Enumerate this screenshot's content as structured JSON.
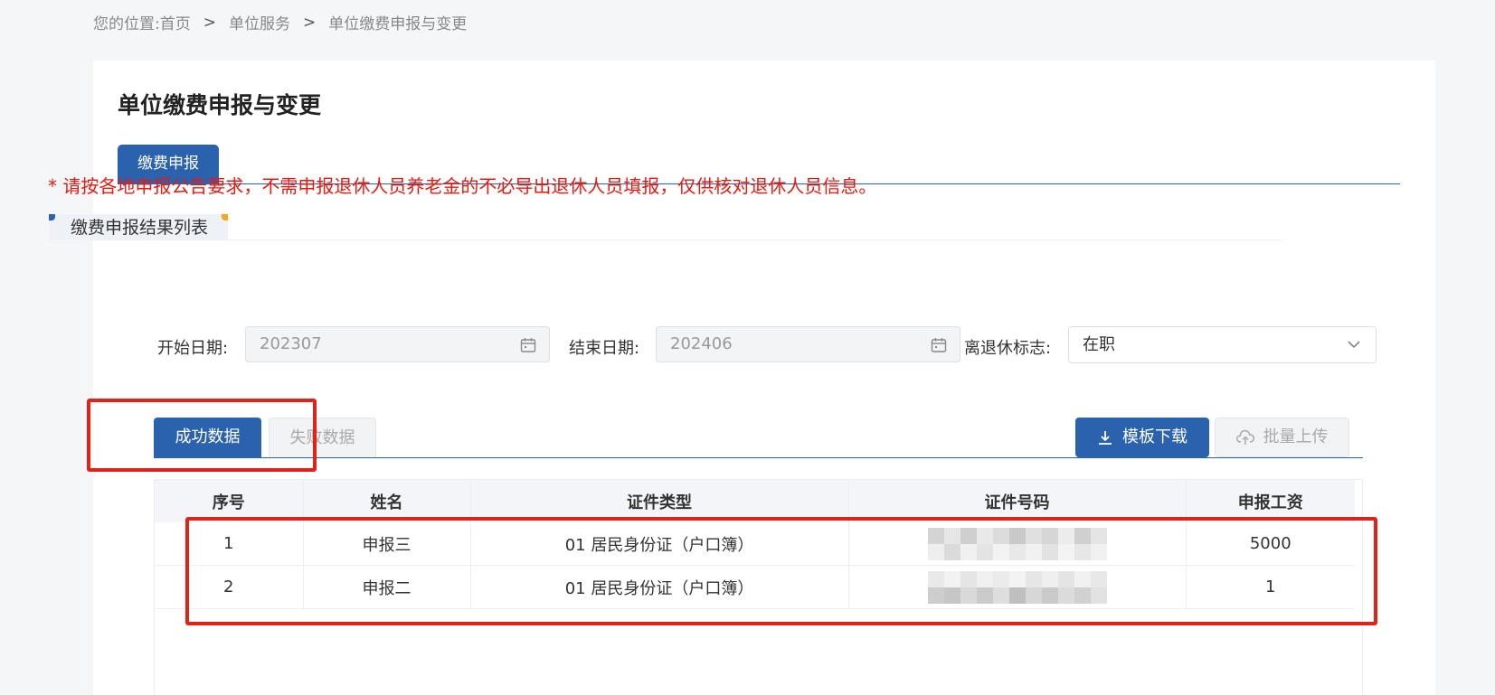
{
  "breadcrumb": {
    "prefix": "您的位置:",
    "items": [
      "首页",
      "单位服务",
      "单位缴费申报与变更"
    ],
    "separator": ">"
  },
  "page": {
    "title": "单位缴费申报与变更"
  },
  "main_tabs": [
    {
      "label": "缴费申报",
      "active": true
    }
  ],
  "notice": "* 请按各地申报公告要求，不需申报退休人员养老金的不必导出退休人员填报，仅供核对退休人员信息。",
  "section": {
    "title": "缴费申报结果列表"
  },
  "filters": {
    "start_date": {
      "label": "开始日期:",
      "value": "202307",
      "icon": "calendar-icon"
    },
    "end_date": {
      "label": "结束日期:",
      "value": "202406",
      "icon": "calendar-icon"
    },
    "retire_flag": {
      "label": "离退休标志:",
      "value": "在职",
      "icon": "chevron-down-icon"
    }
  },
  "sub_tabs": [
    {
      "label": "成功数据",
      "active": true
    },
    {
      "label": "失败数据",
      "active": false
    }
  ],
  "actions": {
    "download": {
      "label": "模板下载",
      "icon": "download-icon"
    },
    "upload": {
      "label": "批量上传",
      "icon": "cloud-upload-icon",
      "disabled": true
    }
  },
  "table": {
    "columns": [
      "序号",
      "姓名",
      "证件类型",
      "证件号码",
      "申报工资"
    ],
    "rows": [
      [
        "1",
        "申报三",
        "01 居民身份证（户口簿）",
        "",
        "5000"
      ],
      [
        "2",
        "申报二",
        "01 居民身份证（户口簿）",
        "",
        "1"
      ]
    ]
  },
  "colors": {
    "primary": "#2b62ad",
    "notice": "#e8190f",
    "annotation": "#e0231a"
  }
}
